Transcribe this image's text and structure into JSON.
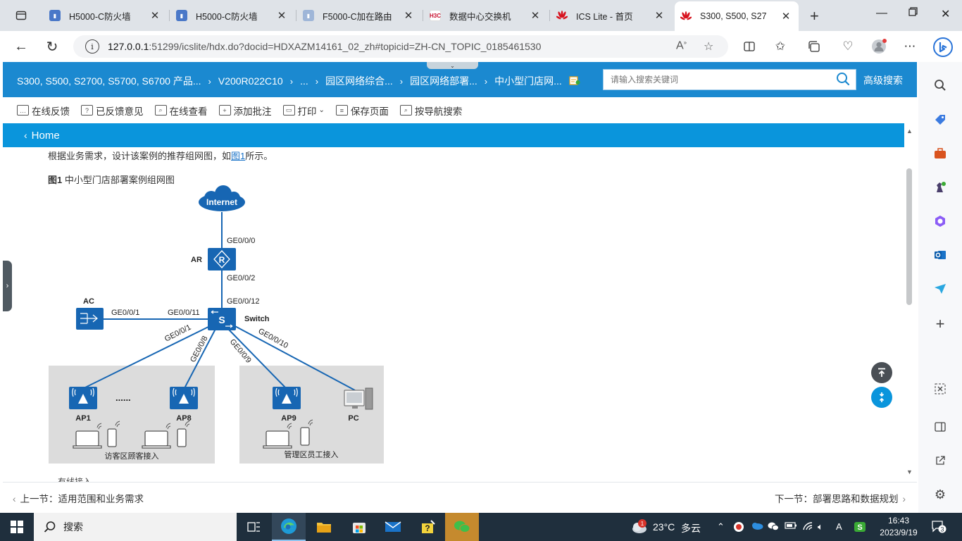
{
  "browser": {
    "tabs": [
      {
        "title": "H5000-C防火墙",
        "close": "✕"
      },
      {
        "title": "H5000-C防火墙",
        "close": "✕"
      },
      {
        "title": "F5000-C加在路由",
        "close": "✕"
      },
      {
        "title": "数据中心交换机",
        "close": "✕",
        "favicon_text": "H3C"
      },
      {
        "title": "ICS Lite - 首页",
        "close": "✕"
      },
      {
        "title": "S300, S500, S27",
        "close": "✕"
      }
    ],
    "url_host": "127.0.0.1",
    "url_rest": ":51299/icslite/hdx.do?docid=HDXAZM14161_02_zh#topicid=ZH-CN_TOPIC_0185461530"
  },
  "doc": {
    "breadcrumbs": [
      "S300, S500, S2700, S5700, S6700 产品...",
      "V200R022C10",
      "...",
      "园区网络综合...",
      "园区网络部署...",
      "中小型门店网..."
    ],
    "search_placeholder": "请输入搜索关键词",
    "advanced_search": "高级搜索",
    "toolbar": [
      "在线反馈",
      "已反馈意见",
      "在线查看",
      "添加批注",
      "打印",
      "保存页面",
      "按导航搜索"
    ],
    "home": "Home",
    "intro_before": "根据业务需求，设计该案例的推荐组网图，如",
    "intro_link": "图1",
    "intro_after": "所示。",
    "fig_label": "图1",
    "fig_title": " 中小型门店部署案例组网图",
    "cutoff_text": "有线接入",
    "prev": "上一节：适用范围和业务需求",
    "next": "下一节：部署思路和数据规划"
  },
  "diagram": {
    "internet": "Internet",
    "ar": "AR",
    "ar_letter": "R",
    "ac": "AC",
    "switch": "Switch",
    "switch_letter": "S",
    "ports": {
      "internet_ar": "GE0/0/0",
      "ar_down": "GE0/0/2",
      "sw_up": "GE0/0/12",
      "ac_port": "GE0/0/1",
      "sw_ac": "GE0/0/11",
      "sw_ap1": "GE0/0/1",
      "sw_ap8": "GE0/0/8",
      "sw_ap9": "GE0/0/9",
      "sw_pc": "GE0/0/10"
    },
    "ap1": "AP1",
    "ap8": "AP8",
    "ap9": "AP9",
    "pc": "PC",
    "dots": "......",
    "guest_zone": "访客区顾客接入",
    "staff_zone": "管理区员工接入"
  },
  "taskbar": {
    "search": "搜索",
    "weather_temp": "23°C",
    "weather_text": "多云",
    "weather_badge": "1",
    "time": "16:43",
    "date": "2023/9/19",
    "notif": "3"
  },
  "colors": {
    "doc_header": "#1b89d0",
    "home_bar": "#0a95dc",
    "device_blue": "#1766b3",
    "zone_gray": "#dcdcdc"
  }
}
